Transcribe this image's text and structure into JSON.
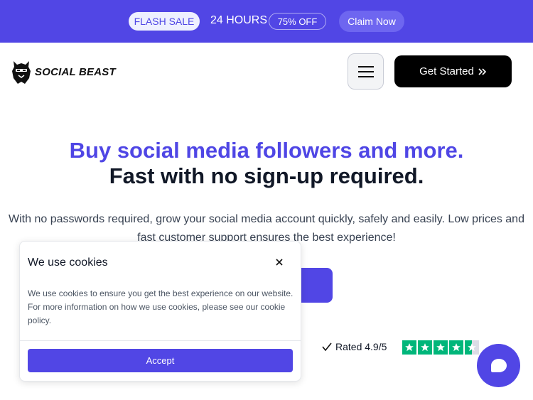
{
  "promo": {
    "flash_label": "FLASH SALE",
    "hours_text": "24 HOURS",
    "discount_label": "75% OFF",
    "claim_label": "Claim Now"
  },
  "header": {
    "brand_name": "SOCIAL BEAST",
    "cta_label": "Get Started",
    "cta_icon": "double-chevron-right-icon",
    "menu_icon": "hamburger-menu-icon"
  },
  "hero": {
    "headline_accent": "Buy social media followers and more.",
    "headline_main": "Fast with no sign-up required.",
    "subtext": "With no passwords required, grow your social media account quickly, safely and easily. Low prices and fast customer support ensures the best experience!"
  },
  "rating": {
    "label": "Rated 4.9/5",
    "stars": 4.5
  },
  "cookie": {
    "title": "We use cookies",
    "body": "We use cookies to ensure you get the best experience on our website. For more information on how we use cookies, please see our cookie policy.",
    "accept_label": "Accept"
  },
  "colors": {
    "brand": "#5146e5",
    "trustpilot": "#00b67a"
  }
}
